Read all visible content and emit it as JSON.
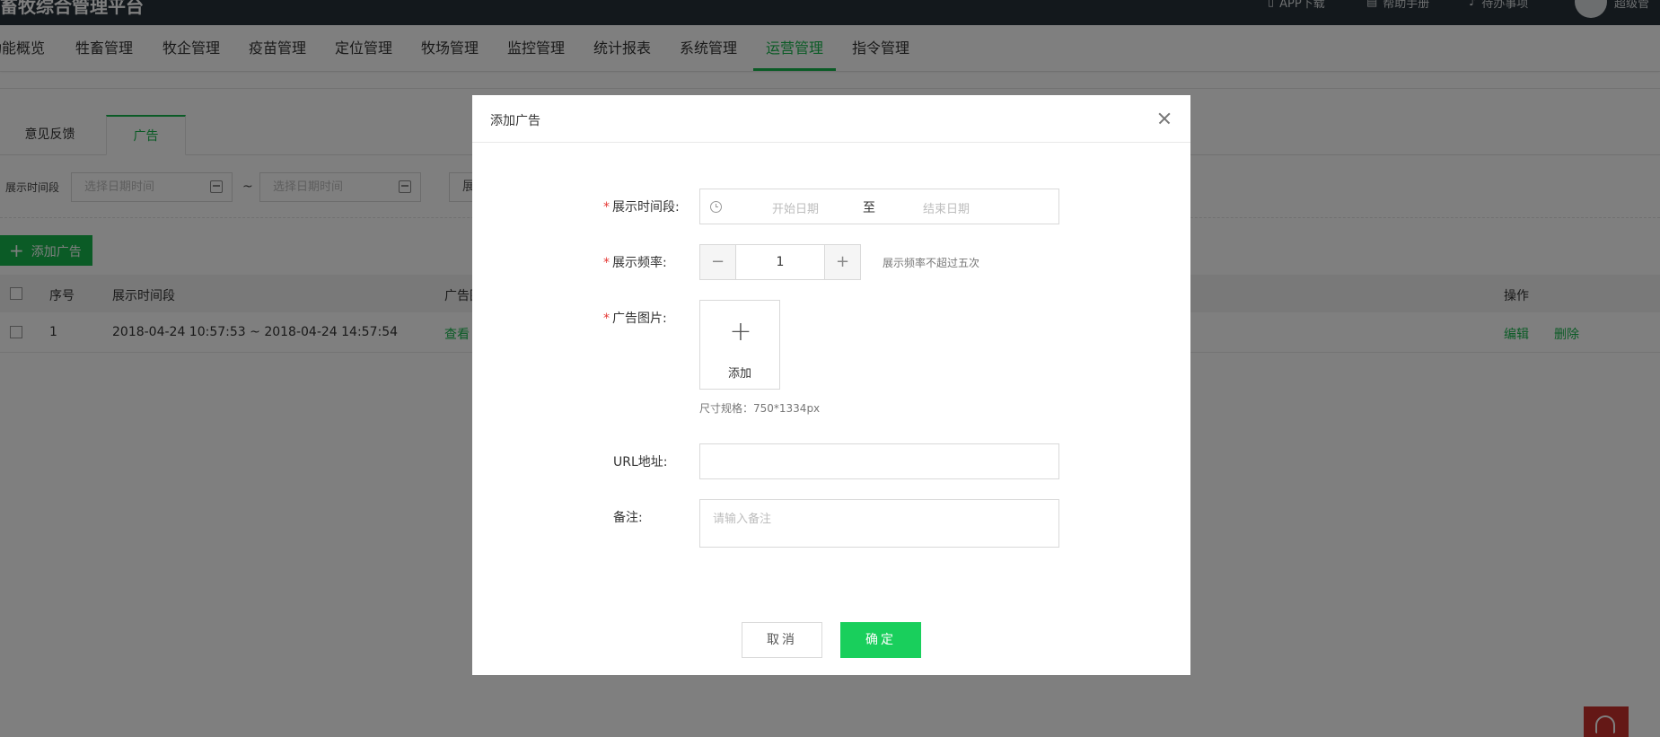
{
  "topbar": {
    "brand": "畜牧综合管理平台",
    "tools": [
      "APP下载",
      "帮助手册",
      "待办事项"
    ],
    "user": "超级管"
  },
  "mainnav": {
    "items": [
      "功能概览",
      "牲畜管理",
      "牧企管理",
      "疫苗管理",
      "定位管理",
      "牧场管理",
      "监控管理",
      "统计报表",
      "系统管理",
      "运营管理",
      "指令管理"
    ],
    "active": "运营管理"
  },
  "tabs": [
    "意见反馈",
    "广告"
  ],
  "filter": {
    "label": "展示时间段",
    "start_placeholder": "选择日期时间",
    "end_placeholder": "选择日期时间",
    "separator": "~",
    "cut_text": "展"
  },
  "add_button": "添加广告",
  "table": {
    "headers": [
      "序号",
      "展示时间段",
      "广告图",
      "操作"
    ],
    "rows": [
      {
        "index": "1",
        "period": "2018-04-24 10:57:53 ~ 2018-04-24 14:57:54",
        "image": "查看",
        "edit": "编辑",
        "delete": "删除"
      }
    ]
  },
  "modal": {
    "title": "添加广告",
    "period_label": "展示时间段:",
    "range": {
      "start_placeholder": "开始日期",
      "separator": "至",
      "end_placeholder": "结束日期"
    },
    "frequency_label": "展示频率:",
    "frequency": {
      "value": "1",
      "minus": "−",
      "plus": "+",
      "hint": "展示频率不超过五次"
    },
    "image_label": "广告图片:",
    "upload": {
      "plus": "+",
      "text": "添加",
      "hint": "尺寸规格：750*1334px"
    },
    "url_label": "URL地址:",
    "note_label": "备注:",
    "note_placeholder": "请输入备注",
    "cancel": "取消",
    "confirm": "确定",
    "required_mark": "*"
  },
  "colors": {
    "accent": "#16b64c",
    "confirm_button": "#19cf5c",
    "topbar": "#263038",
    "required": "#e53935",
    "alert_button": "#c9302c"
  }
}
